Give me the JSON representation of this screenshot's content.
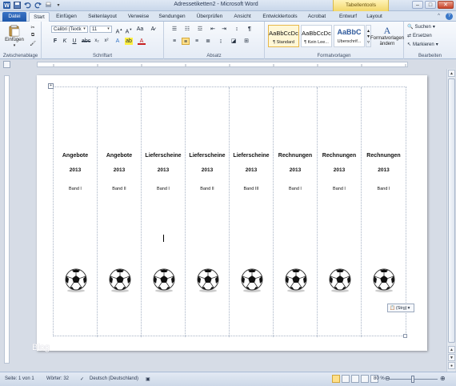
{
  "window": {
    "title": "Adressetiketten2 - Microsoft Word",
    "context_tab": "Tabellentools",
    "buttons": [
      "minimize",
      "maximize",
      "close"
    ]
  },
  "tabs": [
    {
      "label": "Datei"
    },
    {
      "label": "Start"
    },
    {
      "label": "Einfügen"
    },
    {
      "label": "Seitenlayout"
    },
    {
      "label": "Verweise"
    },
    {
      "label": "Sendungen"
    },
    {
      "label": "Überprüfen"
    },
    {
      "label": "Ansicht"
    },
    {
      "label": "Entwicklertools"
    },
    {
      "label": "Acrobat"
    },
    {
      "label": "Entwurf"
    },
    {
      "label": "Layout"
    }
  ],
  "ribbon": {
    "clipboard": {
      "paste": "Einfügen",
      "label": "Zwischenablage"
    },
    "font": {
      "family": "Calibri (Textk",
      "size": "11",
      "label": "Schriftart"
    },
    "paragraph": {
      "label": "Absatz"
    },
    "styles": {
      "items": [
        {
          "sample": "AaBbCcDc",
          "name": "¶ Standard"
        },
        {
          "sample": "AaBbCcDc",
          "name": "¶ Kein Lee..."
        },
        {
          "sample": "AaBbC",
          "name": "Überschrif..."
        }
      ],
      "change": "Formatvorlagen ändern",
      "label": "Formatvorlagen"
    },
    "editing": {
      "find": "Suchen",
      "replace": "Ersetzen",
      "select": "Markieren",
      "label": "Bearbeiten"
    }
  },
  "document": {
    "labels": [
      {
        "title": "Angebote",
        "year": "2013",
        "band": "Band I"
      },
      {
        "title": "Angebote",
        "year": "2013",
        "band": "Band II"
      },
      {
        "title": "Lieferscheine",
        "year": "2013",
        "band": "Band I"
      },
      {
        "title": "Lieferscheine",
        "year": "2013",
        "band": "Band II"
      },
      {
        "title": "Lieferscheine",
        "year": "2013",
        "band": "Band III"
      },
      {
        "title": "Rechnungen",
        "year": "2013",
        "band": "Band I"
      },
      {
        "title": "Rechnungen",
        "year": "2013",
        "band": "Band I"
      },
      {
        "title": "Rechnungen",
        "year": "2013",
        "band": "Band I"
      }
    ],
    "paste_options": "(Strg)",
    "watermark": "Blog"
  },
  "statusbar": {
    "page": "Seite: 1 von 1",
    "words": "Wörter: 32",
    "language": "Deutsch (Deutschland)",
    "zoom": "80 %"
  }
}
